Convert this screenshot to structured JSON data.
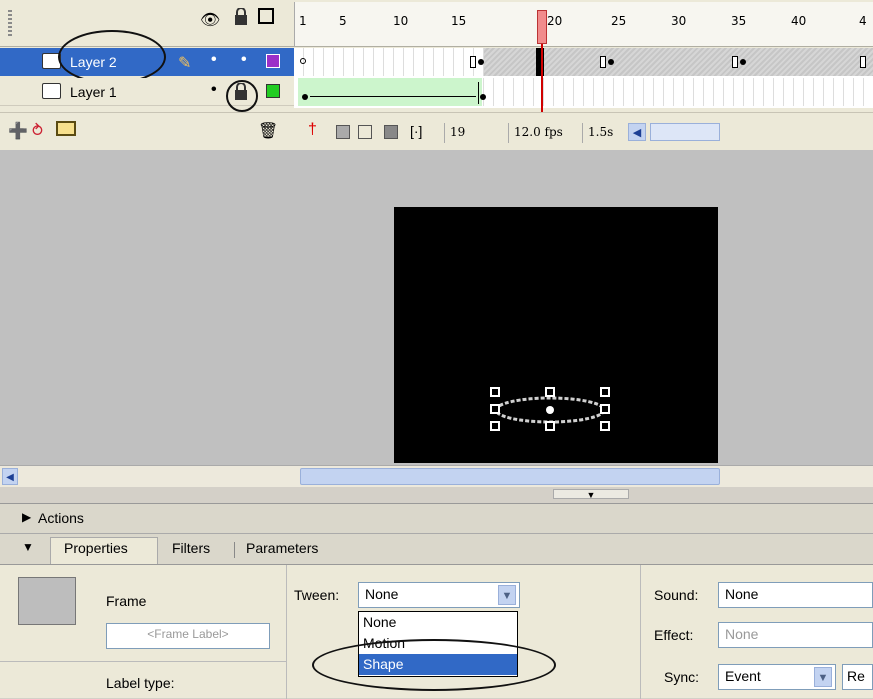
{
  "timeline": {
    "header_icons": [
      "eye-icon",
      "lock-icon",
      "outline-icon"
    ],
    "frame_numbers": [
      "1",
      "5",
      "10",
      "15",
      "20",
      "25",
      "30",
      "35",
      "40",
      "4"
    ],
    "layers": [
      {
        "name": "Layer 2",
        "selected": true,
        "color": "#9b30c8"
      },
      {
        "name": "Layer 1",
        "selected": false,
        "color": "#22cc22"
      }
    ],
    "current_frame": "19",
    "fps": "12.0 fps",
    "elapsed": "1.5s"
  },
  "panels": {
    "actions_label": "Actions",
    "tabs": [
      "Properties",
      "Filters",
      "Parameters"
    ]
  },
  "properties": {
    "type_label": "Frame",
    "frame_label_placeholder": "<Frame Label>",
    "label_type": "Label type:",
    "tween_label": "Tween:",
    "tween_value": "None",
    "tween_options": [
      "None",
      "Motion",
      "Shape"
    ],
    "tween_highlighted": "Shape",
    "sound_label": "Sound:",
    "sound_value": "None",
    "effect_label": "Effect:",
    "effect_value": "None",
    "sync_label": "Sync:",
    "sync_value": "Event",
    "repeat_value": "Re"
  }
}
